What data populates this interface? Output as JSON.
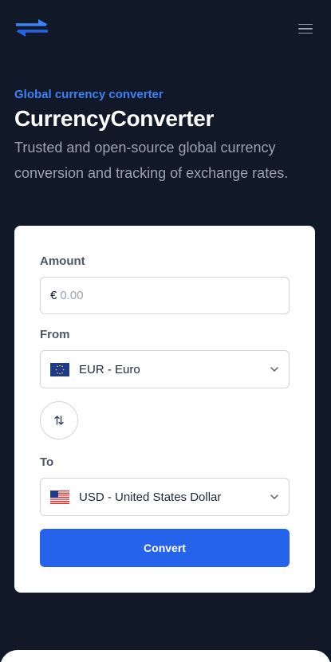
{
  "header": {
    "logo_icon": "swap-arrows-logo-icon",
    "menu_icon": "hamburger-menu-icon",
    "accent_color": "#2563eb"
  },
  "hero": {
    "eyebrow": "Global currency converter",
    "title": "CurrencyConverter",
    "subtitle": "Trusted and open-source global currency conversion and tracking of exchange rates."
  },
  "converter": {
    "amount_label": "Amount",
    "amount_symbol": "€",
    "amount_placeholder": "0.00",
    "amount_value": "",
    "from_label": "From",
    "from_value": "EUR - Euro",
    "from_flag": "eu-flag-icon",
    "swap_icon": "swap-vertical-icon",
    "to_label": "To",
    "to_value": "USD - United States Dollar",
    "to_flag": "us-flag-icon",
    "convert_label": "Convert"
  }
}
